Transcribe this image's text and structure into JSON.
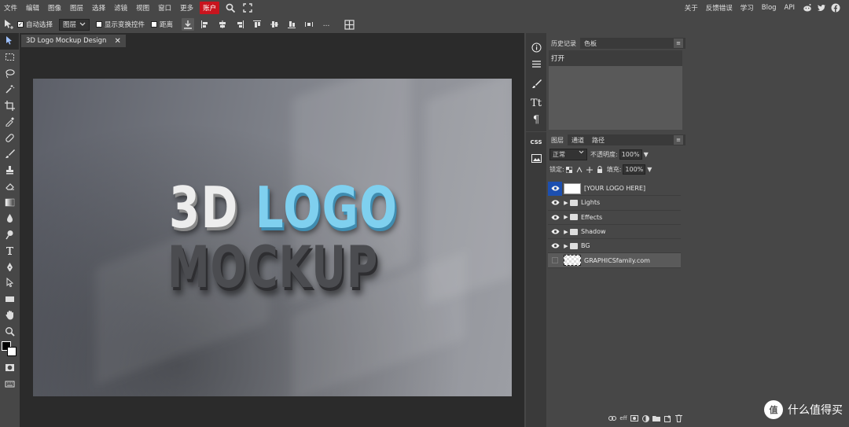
{
  "menu": {
    "items": [
      "文件",
      "编辑",
      "图像",
      "图层",
      "选择",
      "滤镜",
      "视图",
      "窗口",
      "更多"
    ],
    "account": "账户",
    "right_items": [
      "关于",
      "反馈错误",
      "学习",
      "Blog",
      "API"
    ]
  },
  "options": {
    "auto_select": "自动选择",
    "auto_select_checked": true,
    "target": "图层",
    "show_transform": "显示变换控件",
    "distance": "距离",
    "more": "..."
  },
  "document": {
    "tab_title": "3D Logo Mockup Design",
    "close": "✕",
    "headline_white": "3D ",
    "headline_blue": "LOGO",
    "subline": "MOCKUP"
  },
  "side_strip": {
    "css_label": "CSS",
    "text_label": "Tt",
    "para_label": "¶"
  },
  "history": {
    "tabs": [
      "历史记录",
      "色板"
    ],
    "items": [
      "打开"
    ],
    "menu": "≡"
  },
  "layers_panel": {
    "tabs": [
      "图层",
      "通道",
      "路径"
    ],
    "menu": "≡",
    "blend_mode": "正常",
    "opacity_label": "不透明度:",
    "opacity": "100%",
    "lock_label": "锁定:",
    "fill_label": "填充:",
    "fill": "100%",
    "layers": [
      {
        "name": "[YOUR LOGO HERE]",
        "type": "smart",
        "visible": true
      },
      {
        "name": "Lights",
        "type": "folder",
        "visible": true
      },
      {
        "name": "Effects",
        "type": "folder",
        "visible": true
      },
      {
        "name": "Shadow",
        "type": "folder",
        "visible": true
      },
      {
        "name": "BG",
        "type": "folder",
        "visible": true
      },
      {
        "name": "GRAPHICSfamily.com",
        "type": "layer",
        "visible": false
      }
    ]
  },
  "watermark": {
    "symbol": "值",
    "text": "什么值得买"
  },
  "colors": {
    "accent_account": "#c8141e",
    "selected_eye": "#1c4fb0",
    "logo_blue": "#7fd0ef"
  }
}
